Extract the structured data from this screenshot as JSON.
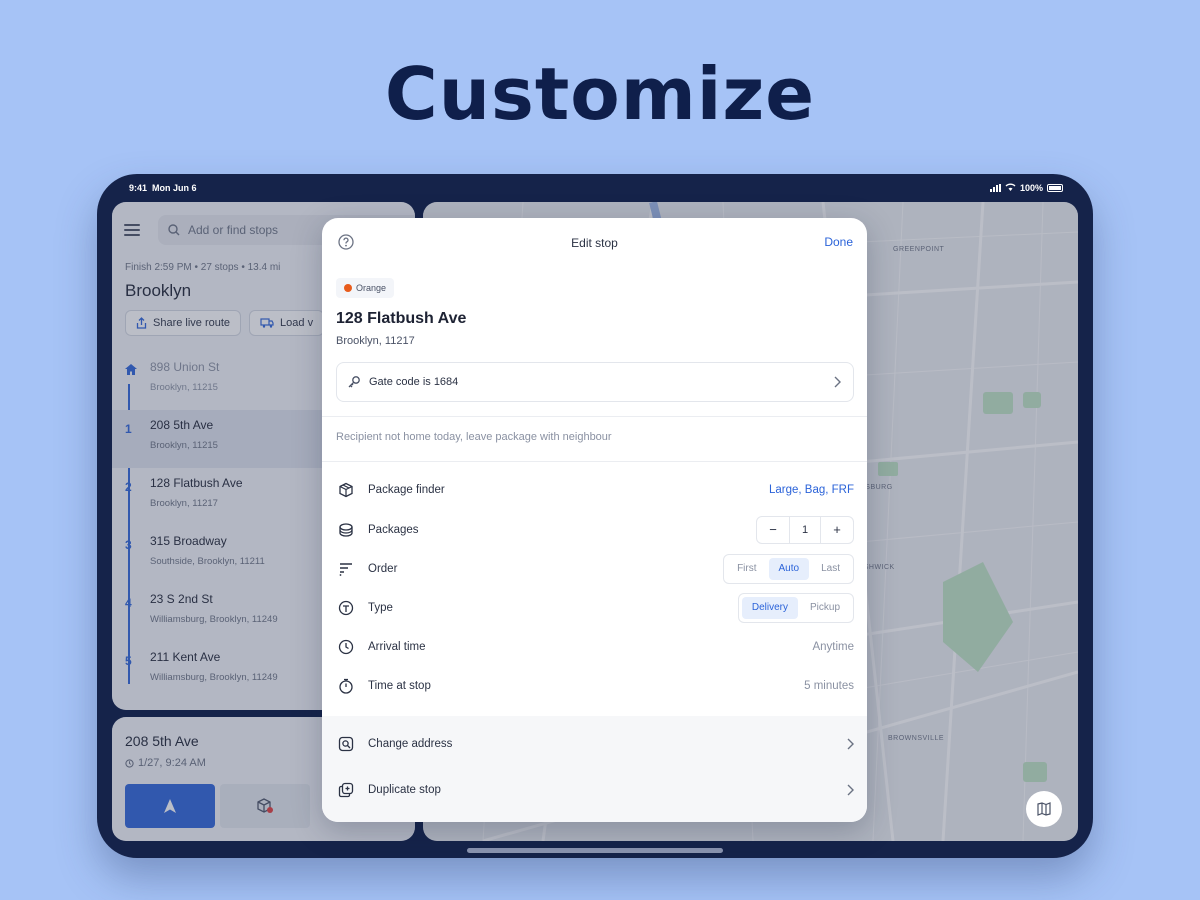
{
  "headline": "Customize",
  "status": {
    "time": "9:41",
    "date": "Mon Jun 6",
    "battery": "100%"
  },
  "sidebar": {
    "search_placeholder": "Add or find stops",
    "route_meta": "Finish 2:59 PM • 27 stops • 13.4 mi",
    "route_title": "Brooklyn",
    "share_label": "Share live route",
    "load_label": "Load v",
    "stops": [
      {
        "num": "",
        "title": "898 Union St",
        "sub": "Brooklyn, 11215"
      },
      {
        "num": "1",
        "title": "208 5th Ave",
        "sub": "Brooklyn, 11215"
      },
      {
        "num": "2",
        "title": "128 Flatbush Ave",
        "sub": "Brooklyn, 11217"
      },
      {
        "num": "3",
        "title": "315 Broadway",
        "sub": "Southside, Brooklyn, 11211"
      },
      {
        "num": "4",
        "title": "23 S 2nd St",
        "sub": "Williamsburg, Brooklyn, 11249"
      },
      {
        "num": "5",
        "title": "211 Kent Ave",
        "sub": "Williamsburg, Brooklyn, 11249"
      }
    ]
  },
  "bottom": {
    "title": "208 5th Ave",
    "eta": "1/27, 9:24 AM"
  },
  "map": {
    "labels": [
      "GREENPOINT",
      "WILLIAMSBURG",
      "BUSHWICK",
      "BROWNSVILLE"
    ]
  },
  "modal": {
    "title": "Edit stop",
    "done": "Done",
    "tag": "Orange",
    "address": "128 Flatbush Ave",
    "address_sub": "Brooklyn, 11217",
    "note": "Gate code is 1684",
    "recipient_note": "Recipient not home today, leave package with neighbour",
    "package_finder": {
      "label": "Package finder",
      "value": "Large, Bag, FRF"
    },
    "packages": {
      "label": "Packages",
      "count": "1",
      "minus": "−",
      "plus": "+"
    },
    "order": {
      "label": "Order",
      "options": [
        "First",
        "Auto",
        "Last"
      ],
      "selected": "Auto"
    },
    "type": {
      "label": "Type",
      "options": [
        "Delivery",
        "Pickup"
      ],
      "selected": "Delivery"
    },
    "arrival": {
      "label": "Arrival time",
      "value": "Anytime"
    },
    "time_at_stop": {
      "label": "Time at stop",
      "value": "5 minutes"
    },
    "change_address": "Change address",
    "duplicate_stop": "Duplicate stop"
  },
  "colors": {
    "accent": "#2b63d9",
    "background": "#a6c3f6",
    "frame": "#15234a",
    "tag_dot": "#e85c1c"
  }
}
